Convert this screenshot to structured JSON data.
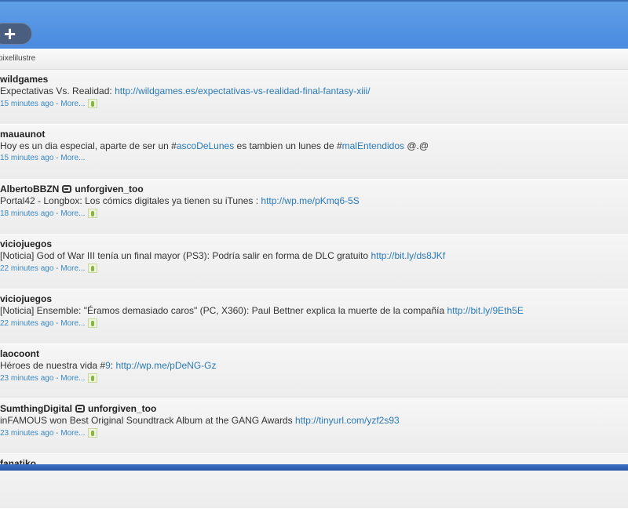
{
  "header": {
    "add_icon": "plus-icon",
    "add_label": "+"
  },
  "account": "pixelilustre",
  "tweets": [
    {
      "user": "wildgames",
      "retweeted_by": "",
      "parts": [
        {
          "t": "Expectativas Vs. Realidad: "
        },
        {
          "l": "http://wildgames.es/expectativas-vs-realidad-final-fantasy-xiii/"
        }
      ],
      "time": "15 minutes ago",
      "more": "More...",
      "geo": true
    },
    {
      "user": "mauaunot",
      "retweeted_by": "",
      "parts": [
        {
          "t": "Hoy es un dia especial, aparte de ser un #"
        },
        {
          "l": "ascoDeLunes"
        },
        {
          "t": " es tambien un lunes de #"
        },
        {
          "l": "malEntendidos"
        },
        {
          "t": " @.@"
        }
      ],
      "time": "15 minutes ago",
      "more": "More...",
      "geo": false
    },
    {
      "user": "AlbertoBBZN",
      "retweeted_by": "unforgiven_too",
      "parts": [
        {
          "t": "Portal42 - Longbox: Los cómics digitales ya tienen su iTunes    : "
        },
        {
          "l": "http://wp.me/pKmq6-5S"
        }
      ],
      "time": "18 minutes ago",
      "more": "More...",
      "geo": true
    },
    {
      "user": "viciojuegos",
      "retweeted_by": "",
      "parts": [
        {
          "t": "[Noticia] God of War III tenía un final mayor (PS3): Podría salir en forma de DLC gratuito "
        },
        {
          "l": "http://bit.ly/ds8JKf"
        }
      ],
      "time": "22 minutes ago",
      "more": "More...",
      "geo": true
    },
    {
      "user": "viciojuegos",
      "retweeted_by": "",
      "parts": [
        {
          "t": "[Noticia] Ensemble: \"Éramos demasiado caros\" (PC, X360): Paul Bettner explica la muerte de la compañía "
        },
        {
          "l": "http://bit.ly/9Eth5E"
        }
      ],
      "time": "22 minutes ago",
      "more": "More...",
      "geo": true
    },
    {
      "user": "laocoont",
      "retweeted_by": "",
      "parts": [
        {
          "t": "Héroes de nuestra vida #"
        },
        {
          "l": "9"
        },
        {
          "t": ": "
        },
        {
          "l": "http://wp.me/pDeNG-Gz"
        }
      ],
      "time": "23 minutes ago",
      "more": "More...",
      "geo": true
    },
    {
      "user": "SumthingDigital",
      "retweeted_by": "unforgiven_too",
      "parts": [
        {
          "t": "inFAMOUS won Best Original Soundtrack Album at the GANG Awards "
        },
        {
          "l": "http://tinyurl.com/yzf2s93"
        }
      ],
      "time": "23 minutes ago",
      "more": "More...",
      "geo": true
    },
    {
      "user": "fanatiko",
      "retweeted_by": "",
      "parts": [],
      "time": "",
      "more": "",
      "geo": false
    }
  ]
}
